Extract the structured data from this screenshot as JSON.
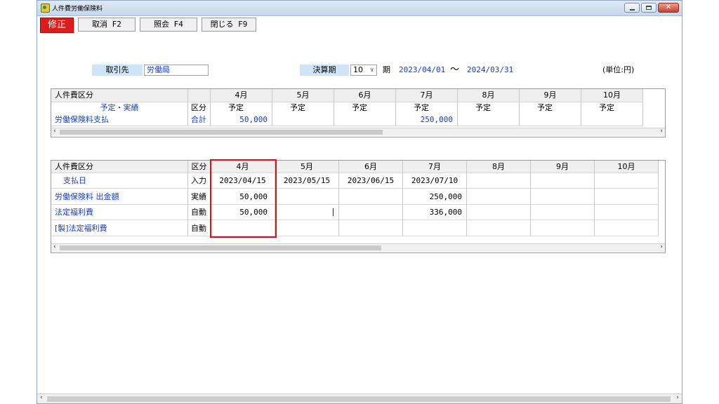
{
  "window": {
    "title": "人件費労働保険料"
  },
  "toolbar": {
    "mode": "修正",
    "cancel": "取消 F2",
    "inquiry": "照会 F4",
    "close": "閉じる F9"
  },
  "filter": {
    "client_label": "取引先",
    "client_value": "労働局",
    "period_label": "決算期",
    "period_value": "10",
    "period_suffix": "期",
    "date_from": "2023/04/01",
    "tilde": "〜",
    "date_to": "2024/03/31",
    "unit": "(単位:円)"
  },
  "grid1": {
    "col_header": "人件費区分",
    "months": [
      "4月",
      "5月",
      "6月",
      "7月",
      "8月",
      "9月",
      "10月"
    ],
    "row1": {
      "label": "予定・実績",
      "kbn": "区分",
      "vals": [
        "予定",
        "予定",
        "予定",
        "予定",
        "予定",
        "予定",
        "予定"
      ]
    },
    "row2": {
      "label": "労働保険料支払",
      "kbn": "合計",
      "vals": [
        "50,000",
        "",
        "",
        "250,000",
        "",
        "",
        ""
      ]
    }
  },
  "grid2": {
    "col_header": "人件費区分",
    "kbn_header": "区分",
    "months": [
      "4月",
      "5月",
      "6月",
      "7月",
      "8月",
      "9月",
      "10月"
    ],
    "rows": [
      {
        "label": "支払日",
        "kbn": "入力",
        "vals": [
          "2023/04/15",
          "2023/05/15",
          "2023/06/15",
          "2023/07/10",
          "",
          "",
          ""
        ]
      },
      {
        "label": "労働保険料 出金額",
        "kbn": "実績",
        "vals": [
          "50,000",
          "",
          "",
          "250,000",
          "",
          "",
          ""
        ]
      },
      {
        "label": "法定福利費",
        "kbn": "自動",
        "vals": [
          "50,000",
          "",
          "",
          "336,000",
          "",
          "",
          ""
        ]
      },
      {
        "label": "[製]法定福利費",
        "kbn": "自動",
        "vals": [
          "",
          "",
          "",
          "",
          "",
          "",
          ""
        ]
      }
    ]
  }
}
